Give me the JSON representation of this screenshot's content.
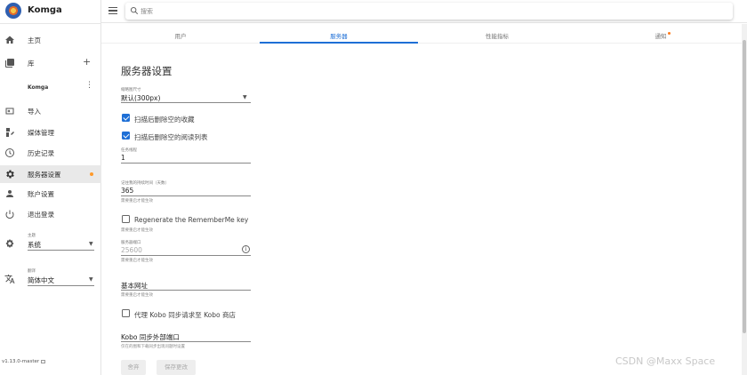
{
  "brand": {
    "name": "Komga"
  },
  "search": {
    "placeholder": "搜索"
  },
  "sidebar": {
    "items": [
      {
        "label": "主页",
        "icon": "home-icon"
      },
      {
        "label": "库",
        "icon": "library-icon",
        "action": "+"
      },
      {
        "label": "Komga",
        "icon": "",
        "action": "⋮"
      },
      {
        "label": "导入",
        "icon": "import-icon"
      },
      {
        "label": "媒体管理",
        "icon": "media-management-icon"
      },
      {
        "label": "历史记录",
        "icon": "history-icon"
      },
      {
        "label": "服务器设置",
        "icon": "gear-icon",
        "active": true
      },
      {
        "label": "账户设置",
        "icon": "account-icon"
      },
      {
        "label": "退出登录",
        "icon": "power-icon"
      }
    ],
    "theme": {
      "caption": "主题",
      "value": "系统",
      "icon": "theme-icon"
    },
    "language": {
      "caption": "翻译",
      "value": "简体中文",
      "icon": "translate-icon"
    },
    "version": "v1.13.0-master"
  },
  "tabs": [
    {
      "label": "用户"
    },
    {
      "label": "服务器",
      "active": true
    },
    {
      "label": "性能指标"
    },
    {
      "label": "通知",
      "badge": true
    }
  ],
  "settings": {
    "title": "服务器设置",
    "thumbnail": {
      "caption": "缩略图尺寸",
      "value": "默认(300px)"
    },
    "check_delete_collections": {
      "label": "扫描后删除空的收藏",
      "checked": true
    },
    "check_delete_readlists": {
      "label": "扫描后删除空的阅读列表",
      "checked": true
    },
    "task_threads": {
      "caption": "任务线程",
      "value": "1"
    },
    "remember_me": {
      "caption": "记住我的持续时间（天数）",
      "value": "365",
      "hint": "需要重启才能生效"
    },
    "regen_key": {
      "label": "Regenerate the RememberMe key",
      "checked": false,
      "hint": "需要重启才能生效"
    },
    "server_port": {
      "caption": "服务器端口",
      "value": "25600",
      "hint": "需要重启才能生效"
    },
    "base_url": {
      "value": "基本网址",
      "hint": "需要重启才能生效"
    },
    "kobo_proxy": {
      "label": "代理 Kobo 同步请求至 Kobo 商店",
      "checked": false
    },
    "kobo_port": {
      "value": "Kobo 同步外部端口",
      "hint": "仅在的图和下载同步出现问题时设置"
    },
    "buttons": {
      "discard": "舍弃",
      "save": "保存更改"
    }
  },
  "watermark": "CSDN @Maxx Space",
  "colors": {
    "accent": "#1e6fd6",
    "notify": "#ff7a1a"
  }
}
